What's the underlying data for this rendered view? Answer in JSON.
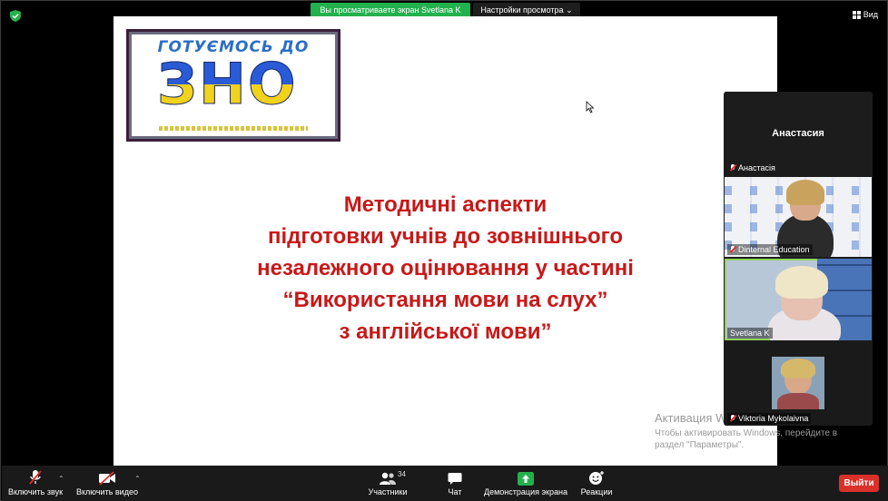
{
  "top_bar": {
    "viewing_text": "Вы просматриваете экран Svetlana K",
    "view_options_label": "Настройки просмотра",
    "view_button_label": "Вид",
    "security_icon": "shield-icon"
  },
  "slide": {
    "logo": {
      "top_text": "ГОТУЄМОСЬ ДО",
      "main_text": "ЗНО",
      "colors": {
        "blue": "#2a5bd7",
        "yellow": "#f2d21b",
        "frame": "#3a1f3a"
      }
    },
    "title_lines": [
      "Методичні аспекти",
      "підготовки учнів до зовнішнього",
      "незалежного оцінювання у частині",
      "“Використання мови на слух”",
      "з англійської мови”"
    ],
    "title_color": "#c81818"
  },
  "participants_panel": {
    "active_speaker_name": "Анастасия",
    "tiles": [
      {
        "name": "Анастасія",
        "muted": true,
        "video": false
      },
      {
        "name": "Dinternal Education",
        "muted": true,
        "video": true
      },
      {
        "name": "Svetlana K",
        "muted": false,
        "video": true
      },
      {
        "name": "Viktoria Mykolaivna",
        "muted": true,
        "video": true
      }
    ]
  },
  "watermark": {
    "heading": "Активация Windows",
    "subtext": "Чтобы активировать Windows, перейдите в раздел \"Параметры\"."
  },
  "toolbar": {
    "audio_label": "Включить звук",
    "video_label": "Включить видео",
    "participants_label": "Участники",
    "participants_count": "34",
    "chat_label": "Чат",
    "share_label": "Демонстрация экрана",
    "reactions_label": "Реакции",
    "leave_label": "Выйти",
    "colors": {
      "share_accent": "#23b14d",
      "leave": "#d9312a"
    }
  }
}
